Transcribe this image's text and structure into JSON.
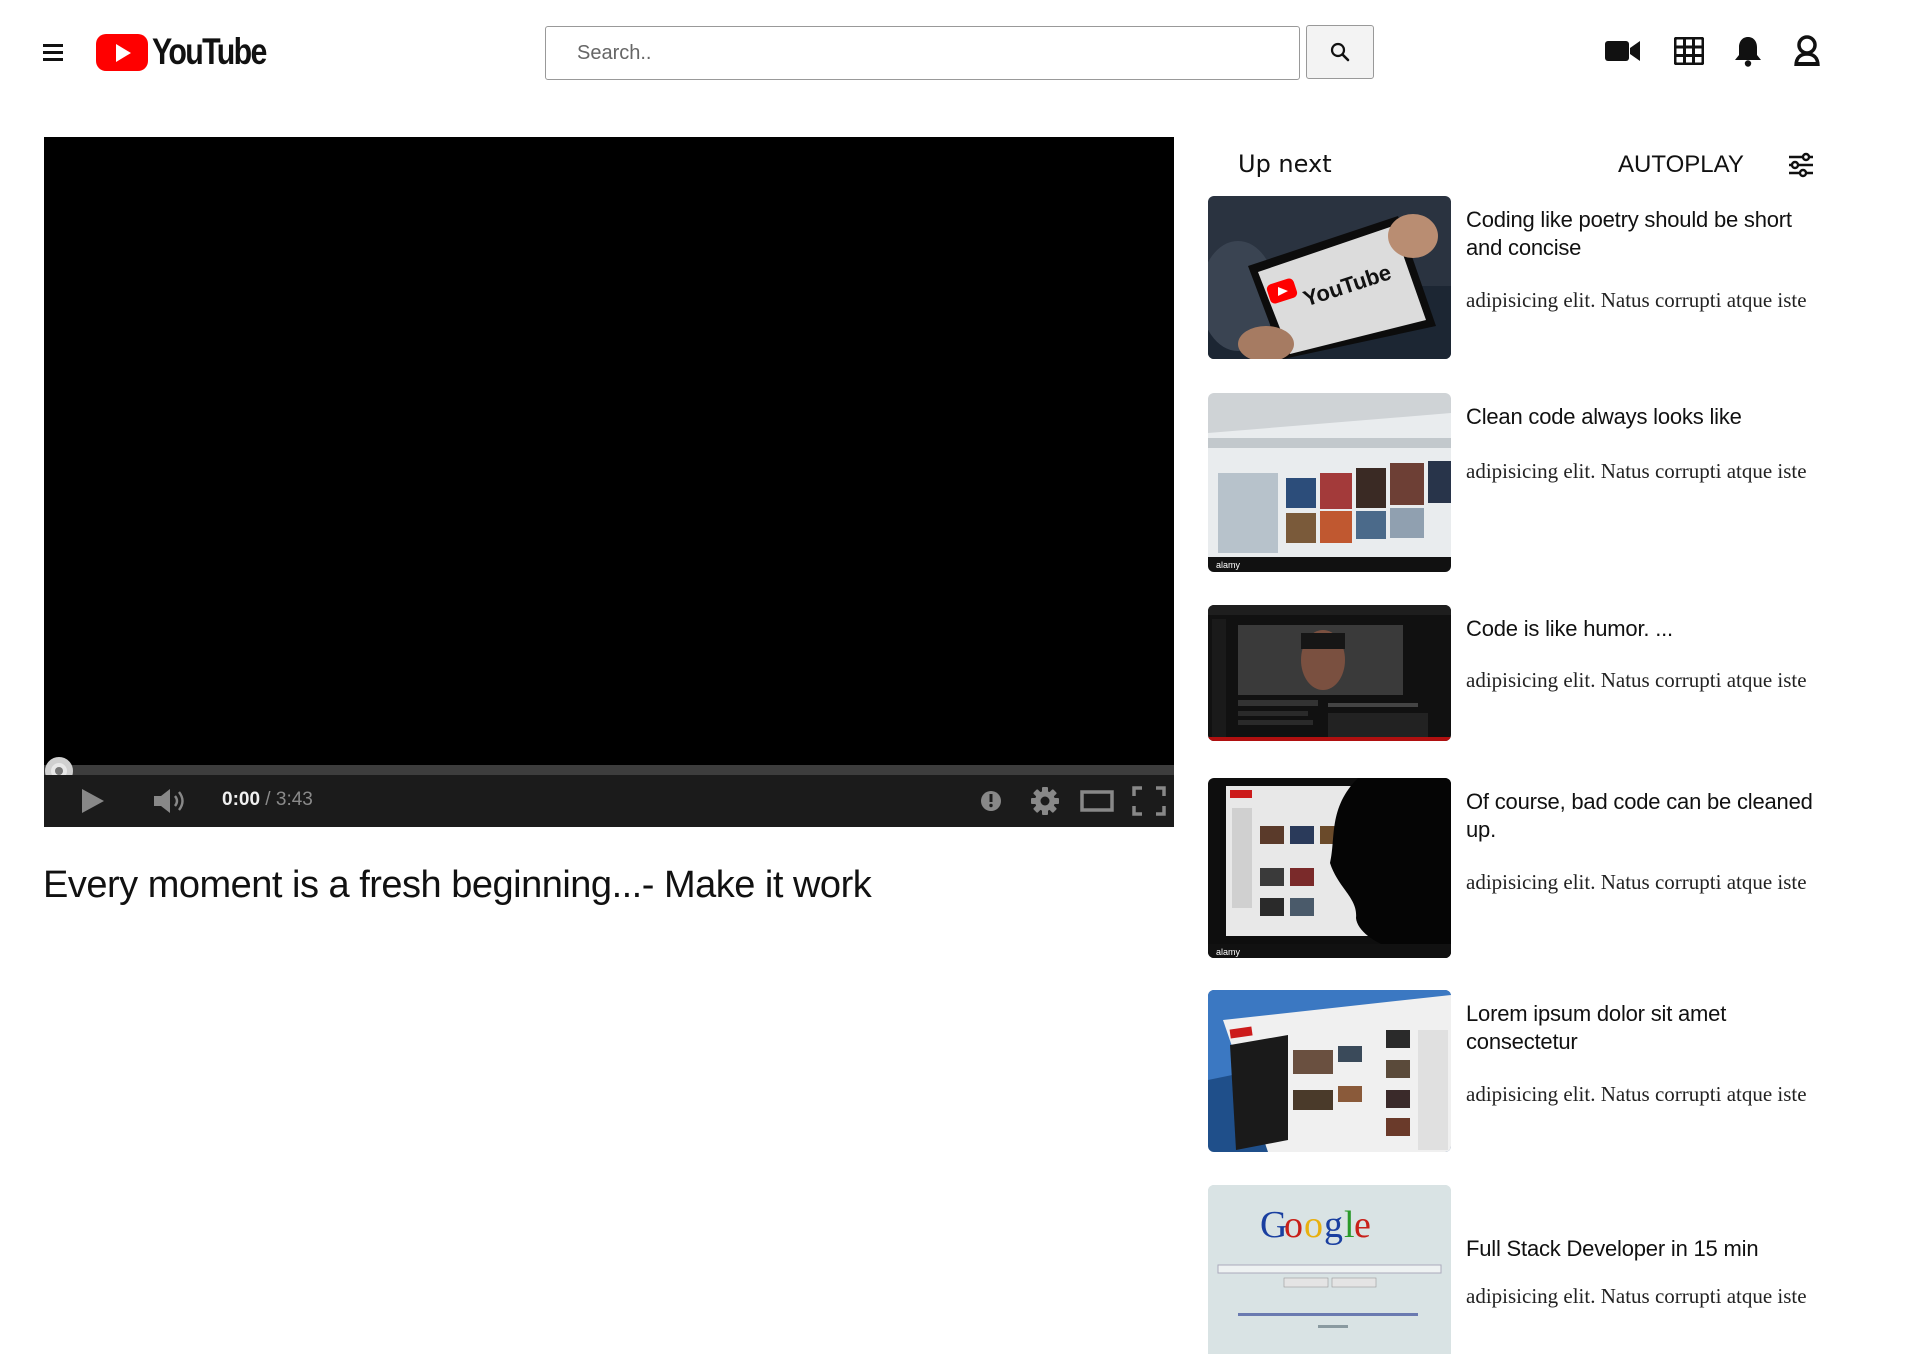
{
  "header": {
    "logo_text": "YouTube",
    "search_placeholder": "Search..",
    "icons": [
      "menu-icon",
      "youtube-logo",
      "search-icon",
      "video-camera-icon",
      "apps-grid-icon",
      "bell-icon",
      "account-icon"
    ]
  },
  "player": {
    "current_time": "0:00",
    "time_separator": " / ",
    "duration": "3:43",
    "progress": 0,
    "controls": [
      "play-icon",
      "volume-icon",
      "info-icon",
      "settings-icon",
      "theater-mode-icon",
      "fullscreen-icon"
    ]
  },
  "video": {
    "title": "Every moment is a fresh beginning...- Make it work"
  },
  "sidebar": {
    "heading": "Up next",
    "autoplay_label": "AUTOPLAY",
    "items": [
      {
        "title": "Coding like poetry should be short and concise",
        "description": "adipisicing elit. Natus corrupti atque iste",
        "thumb_kind": "tablet-youtube"
      },
      {
        "title": "Clean code always looks like",
        "description": "adipisicing elit. Natus corrupti atque iste",
        "thumb_kind": "screen-grid"
      },
      {
        "title": "Code is like humor. ...",
        "description": "adipisicing elit. Natus corrupti atque iste",
        "thumb_kind": "dark-player"
      },
      {
        "title": "Of course, bad code can be cleaned up.",
        "description": "adipisicing elit. Natus corrupti atque iste",
        "thumb_kind": "silhouette-screen"
      },
      {
        "title": "Lorem ipsum dolor sit amet consectetur",
        "description": "adipisicing elit. Natus corrupti atque iste",
        "thumb_kind": "angled-browser"
      },
      {
        "title": "Full Stack Developer in 15 min",
        "description": "adipisicing elit. Natus corrupti atque iste",
        "thumb_kind": "google-home"
      }
    ]
  },
  "colors": {
    "brand_red": "#ff0000",
    "player_bg": "#000000",
    "controls_bg": "#1b1b1b"
  }
}
